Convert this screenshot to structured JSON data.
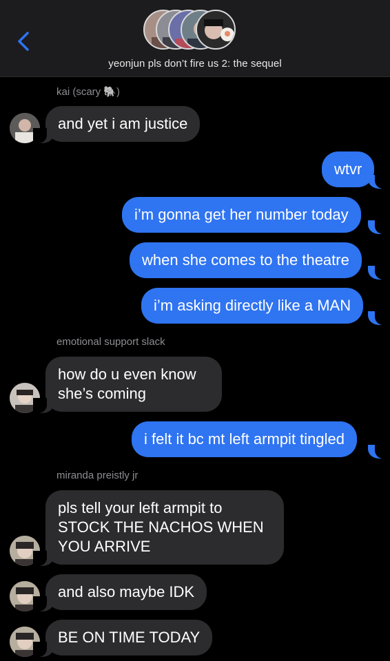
{
  "header": {
    "title": "yeonjun pls don’t fire us 2: the sequel",
    "back_icon": "chevron-left-icon",
    "accent": "#2f74f1"
  },
  "messages": [
    {
      "sender": "kai (scary 🐘)",
      "text": "and yet i am justice",
      "dir": "in"
    },
    {
      "text": "wtvr",
      "dir": "out"
    },
    {
      "text": "i’m gonna get her number today",
      "dir": "out"
    },
    {
      "text": "when she comes to the theatre",
      "dir": "out"
    },
    {
      "text": "i’m asking directly like a MAN",
      "dir": "out"
    },
    {
      "sender": "emotional support slack",
      "text": "how do u even know she’s coming",
      "dir": "in"
    },
    {
      "text": "i felt it bc mt left armpit tingled",
      "dir": "out"
    },
    {
      "sender": "miranda preistly jr",
      "text": "pls tell your left armpit to STOCK THE NACHOS WHEN YOU ARRIVE",
      "dir": "in"
    },
    {
      "text": "and also maybe IDK",
      "dir": "in"
    },
    {
      "text": "BE ON TIME TODAY",
      "dir": "in"
    }
  ],
  "colors": {
    "incoming_bubble": "#2c2c2e",
    "outgoing_bubble": "#2f74f1",
    "background": "#000000",
    "sender_label": "#8e8e93"
  }
}
